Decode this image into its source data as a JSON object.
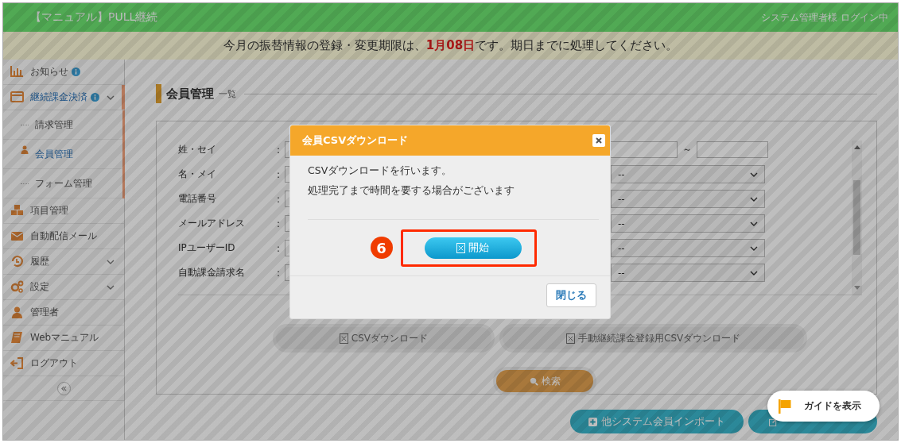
{
  "header": {
    "title": "【マニュアル】PULL継続",
    "user": "システム管理者様 ログイン中"
  },
  "notice": {
    "text": "今月の振替情報の登録・変更期限は、**1月08日**です。期日までに処理してください。"
  },
  "sidebar": {
    "items": [
      {
        "label": "お知らせ",
        "info": true,
        "chevron": false,
        "selected": false
      },
      {
        "label": "継続課金決済",
        "info": true,
        "chevron": true,
        "selected": true,
        "children": [
          {
            "label": "請求管理",
            "selected": false
          },
          {
            "label": "会員管理",
            "selected": true
          },
          {
            "label": "フォーム管理",
            "selected": false
          }
        ]
      },
      {
        "label": "項目管理",
        "info": false,
        "chevron": false,
        "selected": false
      },
      {
        "label": "自動配信メール",
        "info": false,
        "chevron": false,
        "selected": false
      },
      {
        "label": "履歴",
        "info": false,
        "chevron": true,
        "selected": false
      },
      {
        "label": "設定",
        "info": false,
        "chevron": true,
        "selected": false
      },
      {
        "label": "管理者",
        "info": false,
        "chevron": false,
        "selected": false
      },
      {
        "label": "Webマニュアル",
        "info": false,
        "chevron": false,
        "selected": false
      },
      {
        "label": "ログアウト",
        "info": false,
        "chevron": false,
        "selected": false
      }
    ]
  },
  "page": {
    "title": "会員管理",
    "subtitle": "一覧"
  },
  "form": {
    "rows": [
      {
        "label": "姓・セイ",
        "colon": ":",
        "kind": "range",
        "separator": "～"
      },
      {
        "label": "名・メイ",
        "colon": ":",
        "kind": "select",
        "value": "--"
      },
      {
        "label": "電話番号",
        "colon": ":",
        "kind": "select",
        "value": "--"
      },
      {
        "label": "メールアドレス",
        "colon": ":",
        "kind": "select",
        "value": "--"
      },
      {
        "label": "IPユーザーID",
        "colon": ":",
        "kind": "select",
        "value": "--"
      },
      {
        "label": "自動課金請求名",
        "colon": ":",
        "kind": "select",
        "value": "--"
      }
    ]
  },
  "downloads": [
    "CSVダウンロード",
    "手動継続課金登録用CSVダウンロード"
  ],
  "search_button": "検索",
  "bottom_buttons": [
    {
      "kind": "import",
      "label": "他システム会員インポート"
    },
    {
      "kind": "edit"
    }
  ],
  "modal": {
    "title": "会員CSVダウンロード",
    "lines": [
      "CSVダウンロードを行います。",
      "処理完了まで時間を要する場合がございます"
    ],
    "step": "6",
    "start_button": "開始",
    "close_button": "閉じる"
  },
  "guide_button": "ガイドを表示"
}
